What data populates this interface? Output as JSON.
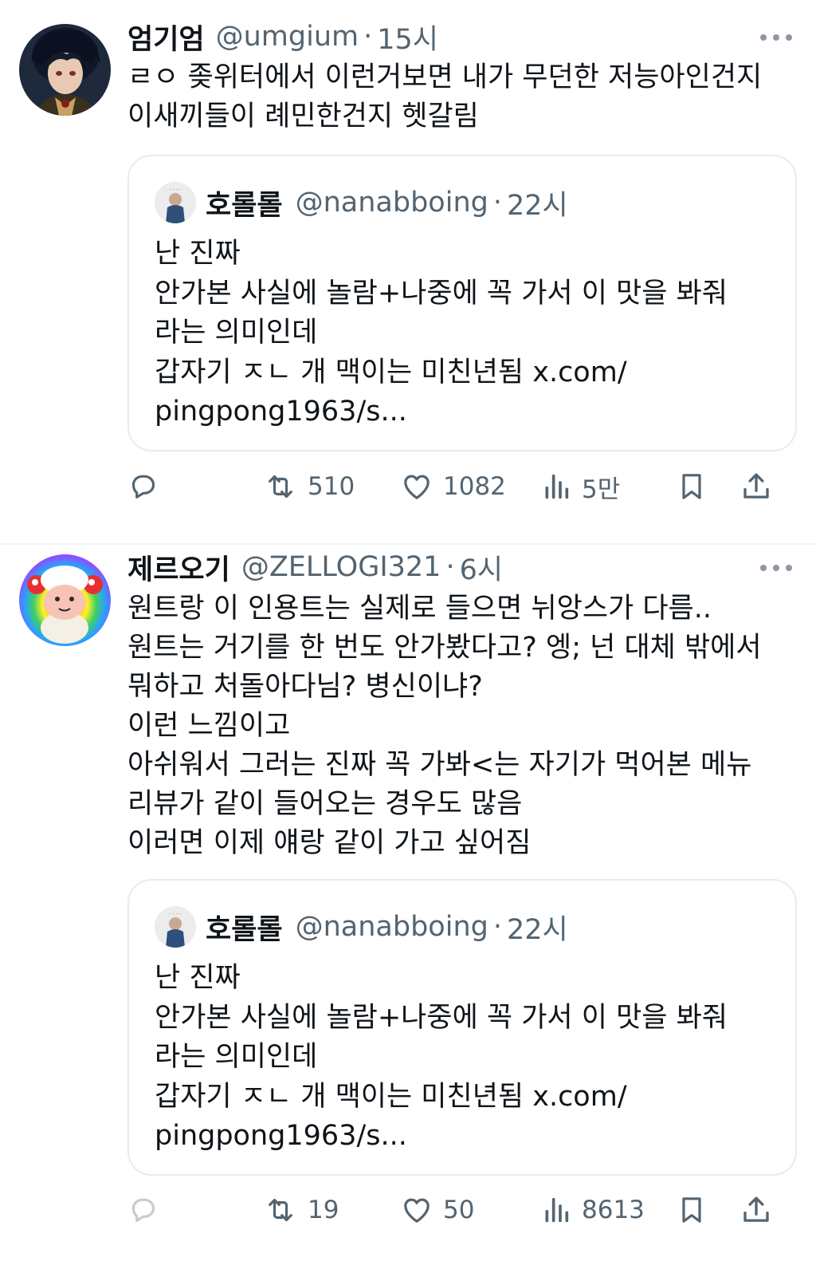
{
  "tweets": [
    {
      "name": "엄기엄",
      "handle": "@umgium",
      "dot": "·",
      "time": "15시",
      "text": [
        "ㄹㅇ 좆위터에서 이런거보면 내가 무던한 저능아인건지",
        "이새끼들이 례민한건지 헷갈림"
      ],
      "quote": {
        "name": "호롤롤",
        "handle": "@nanabboing",
        "dot": "·",
        "time": "22시",
        "text": [
          "난 진짜",
          "안가본 사실에 놀람+나중에 꼭 가서 이 맛을 봐줘",
          "라는 의미인데",
          "갑자기 ㅈㄴ 개 맥이는 미친년됨 x.com/",
          "pingpong1963/s..."
        ]
      },
      "actions": {
        "reply": "",
        "retweets": "510",
        "likes": "1082",
        "views": "5만"
      },
      "icons": [
        "reply-icon",
        "retweet-icon",
        "like-icon",
        "views-icon",
        "bookmark-icon",
        "share-icon",
        "more-icon"
      ]
    },
    {
      "name": "제르오기",
      "handle": "@ZELLOGI321",
      "dot": "·",
      "time": "6시",
      "text": [
        "원트랑 이 인용트는 실제로 들으면 뉘앙스가 다름..",
        "원트는 거기를 한 번도 안가봤다고? 엥; 넌 대체 밖에서",
        "뭐하고 처돌아다님? 병신이냐?",
        "이런 느낌이고",
        "아쉬워서 그러는 진짜 꼭 가봐<는 자기가 먹어본 메뉴",
        "리뷰가 같이 들어오는 경우도 많음",
        "이러면 이제 얘랑 같이 가고 싶어짐"
      ],
      "quote": {
        "name": "호롤롤",
        "handle": "@nanabboing",
        "dot": "·",
        "time": "22시",
        "text": [
          "난 진짜",
          "안가본 사실에 놀람+나중에 꼭 가서 이 맛을 봐줘",
          "라는 의미인데",
          "갑자기 ㅈㄴ 개 맥이는 미친년됨 x.com/",
          "pingpong1963/s..."
        ]
      },
      "actions": {
        "reply": "",
        "retweets": "19",
        "likes": "50",
        "views": "8613"
      }
    }
  ],
  "colors": {
    "text": "#0f1419",
    "secondary": "#536471",
    "border": "#e6ecf0"
  }
}
